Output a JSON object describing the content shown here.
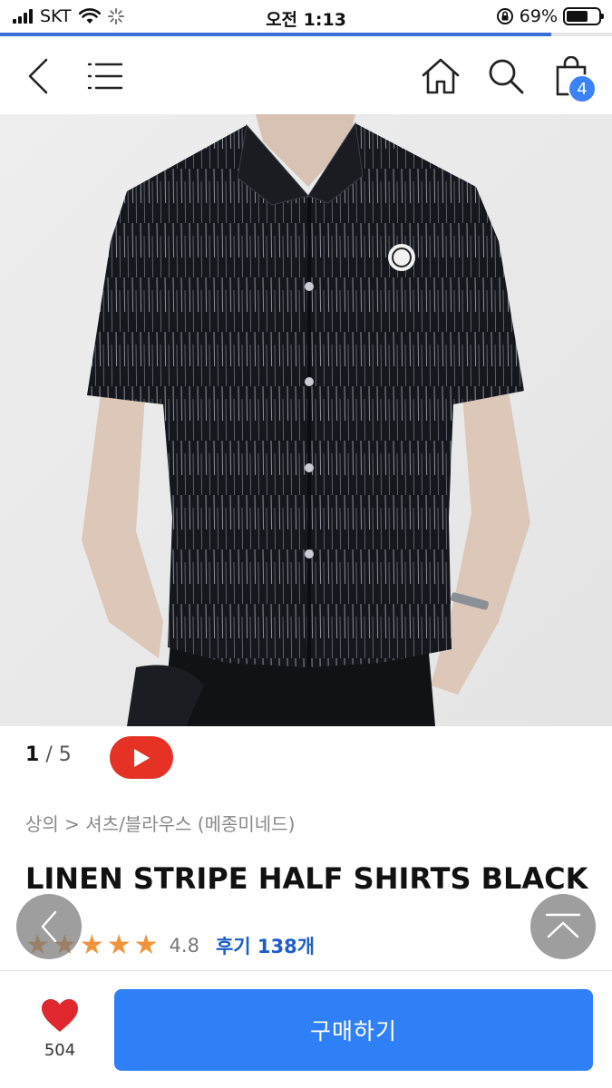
{
  "status_bar": {
    "carrier": "SKT",
    "time": "오전 1:13",
    "battery": "69%",
    "page_load_progress": 0.9
  },
  "nav": {
    "back_icon": "chevron-left-icon",
    "menu_icon": "hamburger-menu-icon",
    "home_icon": "home-icon",
    "search_icon": "search-icon",
    "cart_icon": "shopping-bag-icon",
    "cart_count": "4"
  },
  "gallery": {
    "current": "1",
    "separator": "/",
    "total": "5",
    "video_icon": "play-icon"
  },
  "product": {
    "breadcrumb": "상의 > 셔츠/블라우스 (메종미네드)",
    "title": "LINEN STRIPE HALF SHIRTS BLACK",
    "stars_icon": "star-icon",
    "rating_stars": 5,
    "score": "4.8",
    "reviews": "후기 138개"
  },
  "floating": {
    "prev_icon": "chevron-left-icon",
    "top_icon": "scroll-to-top-icon"
  },
  "bottom_bar": {
    "like_icon": "heart-icon",
    "like_count": "504",
    "buy_label": "구매하기"
  },
  "colors": {
    "accent_blue": "#2f7ff7",
    "star_orange": "#f0953d",
    "youtube_red": "#e53225",
    "heart_red": "#e0282e"
  }
}
